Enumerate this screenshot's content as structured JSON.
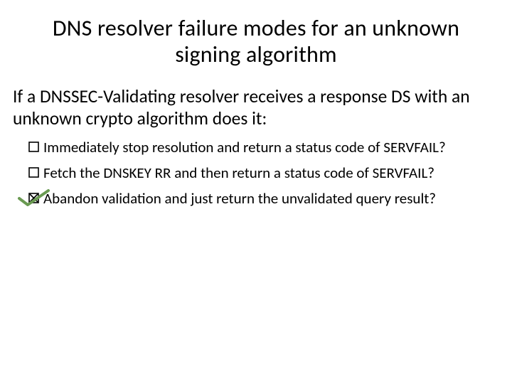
{
  "title": "DNS resolver failure modes for an unknown signing algorithm",
  "intro": "If a DNSSEC-Validating resolver receives a response DS with an unknown crypto algorithm does it:",
  "options": [
    {
      "text": "Immediately stop resolution and return a status code of SERVFAIL?",
      "checked": false
    },
    {
      "text": "Fetch the DNSKEY RR and then return a status code of SERVFAIL?",
      "checked": false
    },
    {
      "text": "Abandon validation and just return the unvalidated query result?",
      "checked": true
    }
  ],
  "colors": {
    "checkmark": "#6a9a52"
  }
}
